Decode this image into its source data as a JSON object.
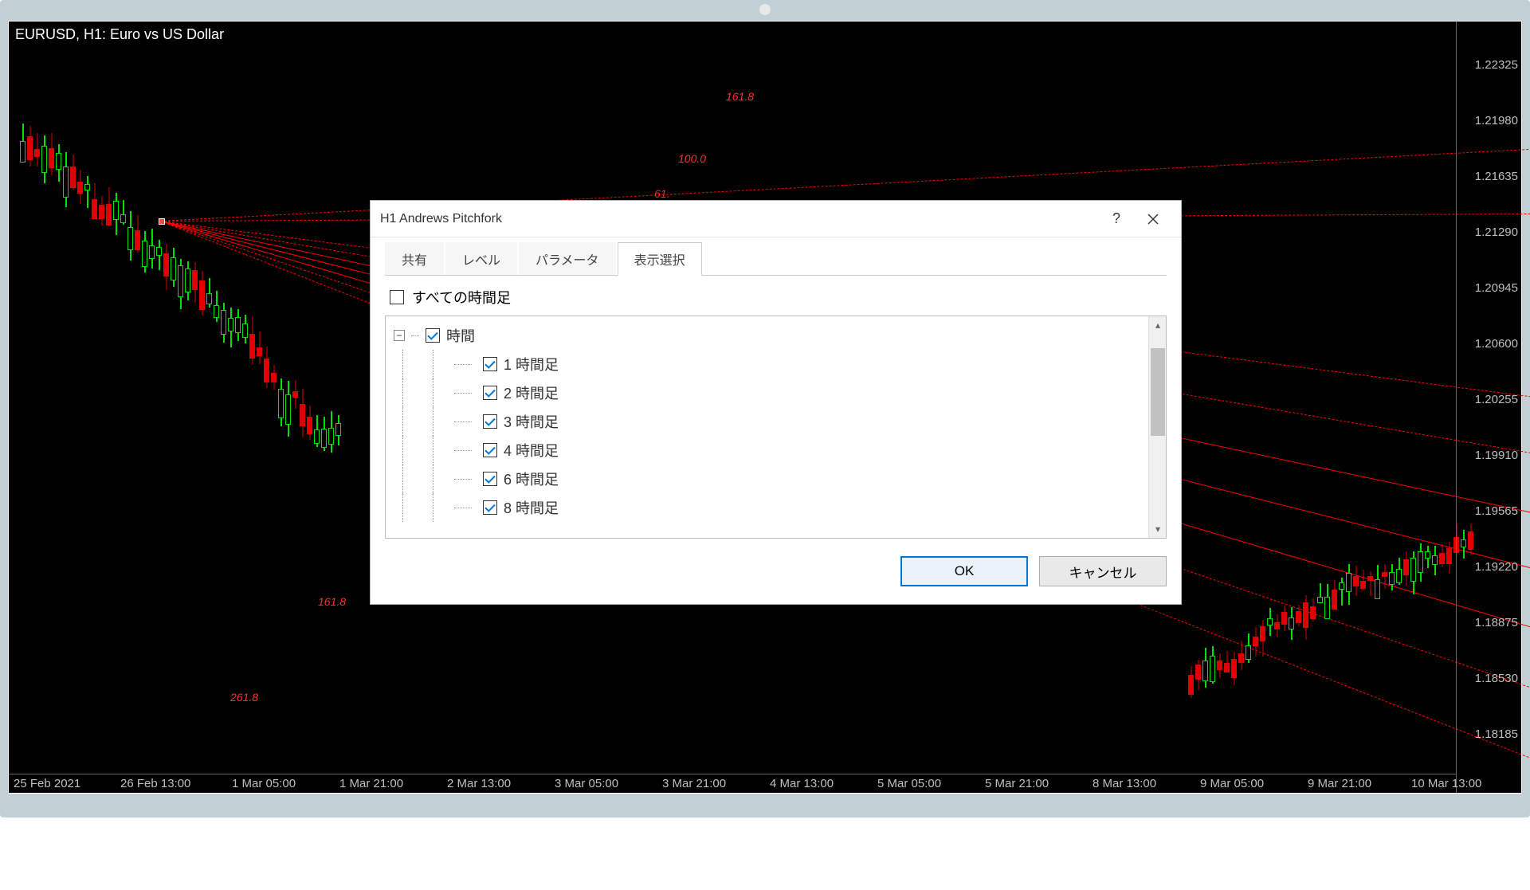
{
  "chart": {
    "title": "EURUSD, H1:  Euro vs US Dollar",
    "price_labels": [
      "1.22325",
      "1.21980",
      "1.21635",
      "1.21290",
      "1.20945",
      "1.20600",
      "1.20255",
      "1.19910",
      "1.19565",
      "1.19220",
      "1.18875",
      "1.18530",
      "1.18185"
    ],
    "time_labels": [
      "25 Feb 2021",
      "26 Feb 13:00",
      "1 Mar 05:00",
      "1 Mar 21:00",
      "2 Mar 13:00",
      "3 Mar 05:00",
      "3 Mar 21:00",
      "4 Mar 13:00",
      "5 Mar 05:00",
      "5 Mar 21:00",
      "8 Mar 13:00",
      "9 Mar 05:00",
      "9 Mar 21:00",
      "10 Mar 13:00"
    ],
    "pf_labels": {
      "a": "161.8",
      "b": "100.0",
      "c": "61.",
      "d": "161.8",
      "e": "261.8"
    }
  },
  "dialog": {
    "title": "H1 Andrews Pitchfork",
    "tabs": {
      "t1": "共有",
      "t2": "レベル",
      "t3": "パラメータ",
      "t4": "表示選択"
    },
    "all_tf": "すべての時間足",
    "tree_root": "時間",
    "tree": {
      "h1": "1 時間足",
      "h2": "2 時間足",
      "h3": "3 時間足",
      "h4": "4 時間足",
      "h6": "6 時間足",
      "h8": "8 時間足"
    },
    "ok": "OK",
    "cancel": "キャンセル"
  }
}
